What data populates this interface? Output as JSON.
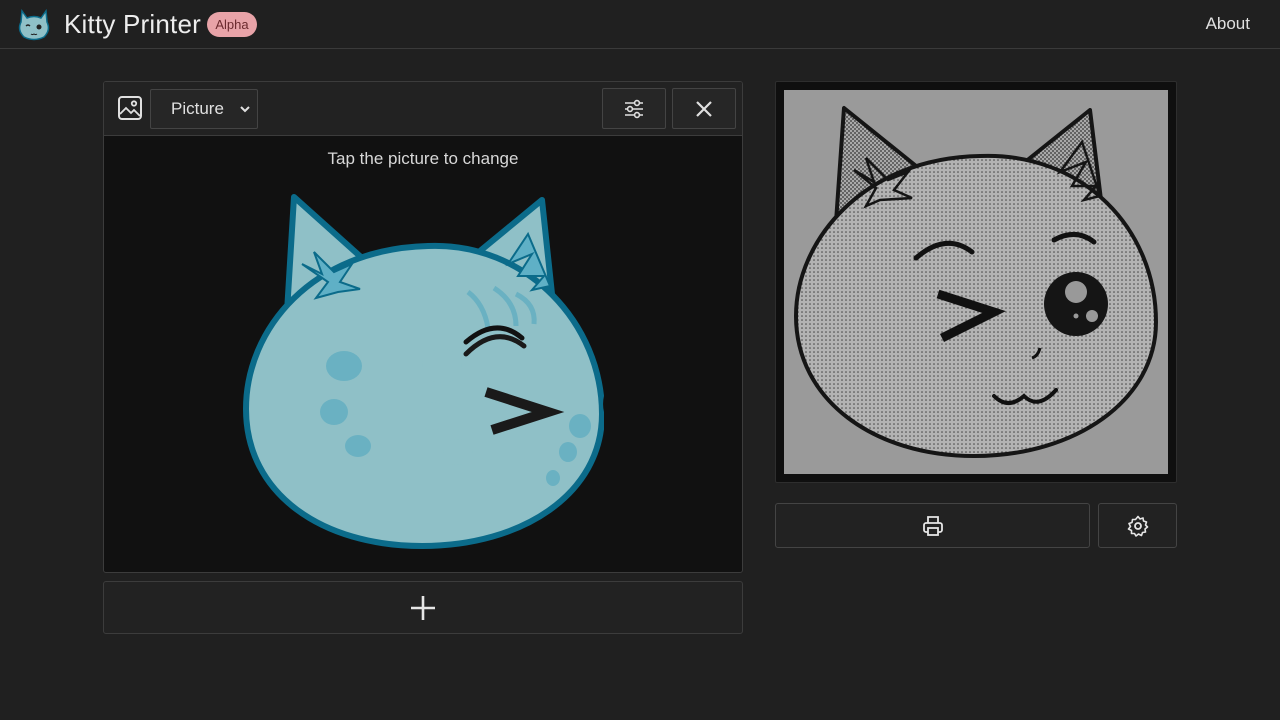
{
  "header": {
    "brand_name": "Kitty Printer",
    "badge": "Alpha",
    "nav_link": "About",
    "logo_icon": "kitty-logo-icon"
  },
  "editor": {
    "type_icon": "image-icon",
    "type_select": {
      "selected": "Picture"
    },
    "filter_icon": "sliders-icon",
    "close_icon": "close-icon",
    "hint": "Tap the picture to change",
    "add_icon": "plus-icon"
  },
  "preview": {
    "print_icon": "printer-icon",
    "settings_icon": "gear-icon"
  },
  "colors": {
    "background": "#202020",
    "card_background": "#111111",
    "cat_fill": "#8fc0c7",
    "cat_outline": "#0b6b8a",
    "badge_bg": "#e8a3a8",
    "preview_bg": "#9a9a9a"
  }
}
